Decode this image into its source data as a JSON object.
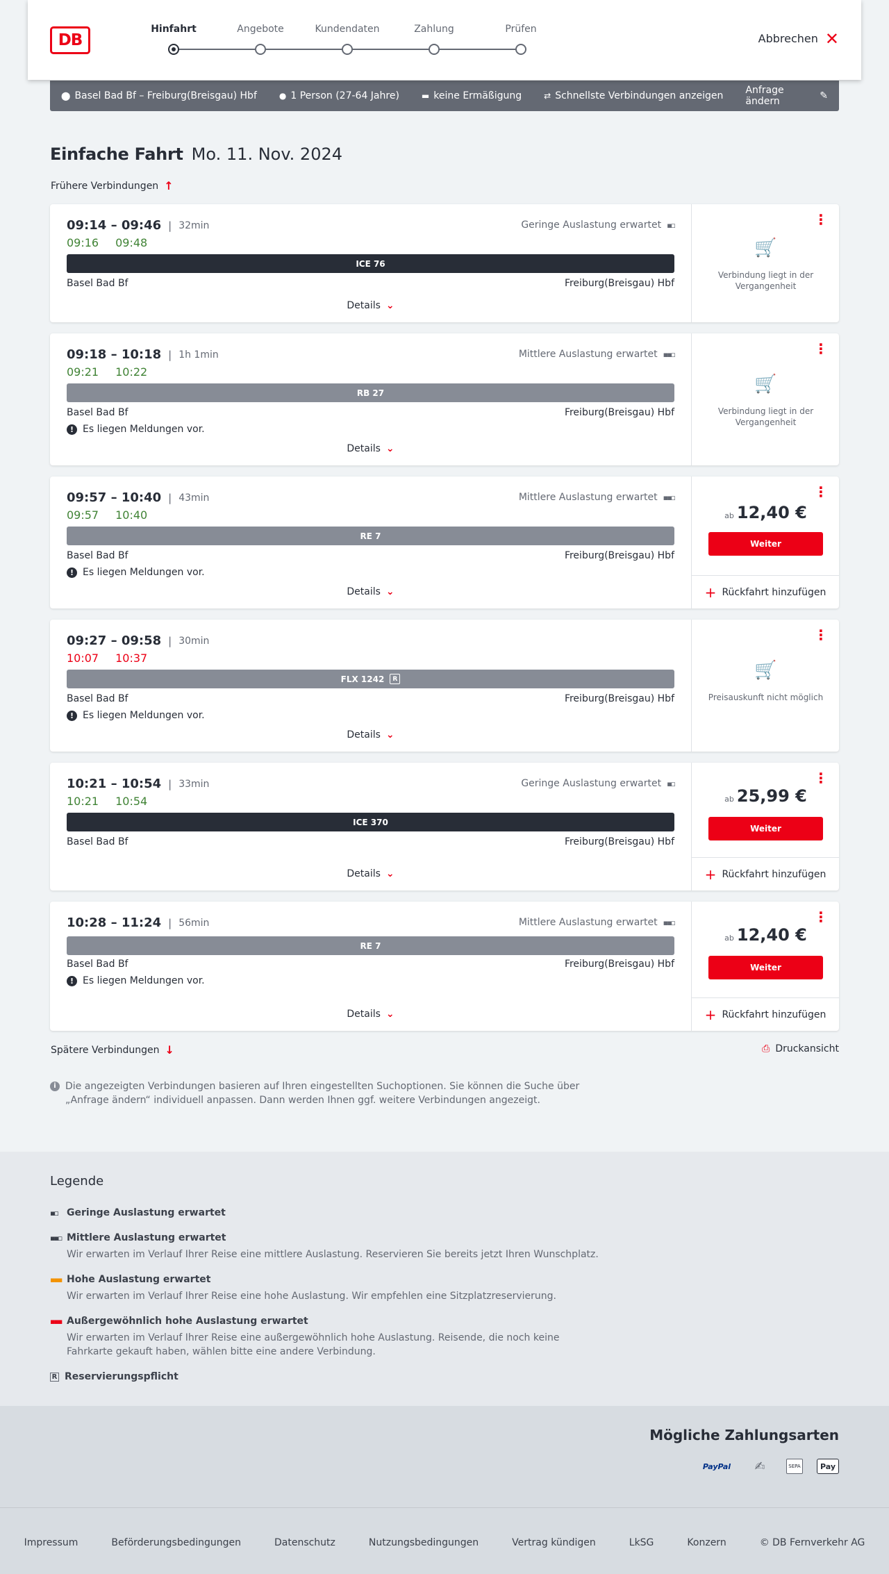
{
  "header": {
    "logo": "DB",
    "steps": [
      "Hinfahrt",
      "Angebote",
      "Kundendaten",
      "Zahlung",
      "Prüfen"
    ],
    "active_step": 0,
    "cancel_label": "Abbrechen"
  },
  "query": {
    "route": "Basel Bad Bf – Freiburg(Breisgau) Hbf",
    "passengers": "1 Person (27-64 Jahre)",
    "discount": "keine Ermäßigung",
    "fastest": "Schnellste Verbindungen anzeigen",
    "edit_label": "Anfrage ändern"
  },
  "page": {
    "title": "Einfache Fahrt",
    "date": "Mo. 11. Nov. 2024",
    "earlier_label": "Frühere Verbindungen",
    "later_label": "Spätere Verbindungen",
    "print_label": "Druckansicht",
    "info_text": "Die angezeigten Verbindungen basieren auf Ihren eingestellten Suchoptionen. Sie können die Suche über „Anfrage ändern“ individuell anpassen. Dann werden Ihnen ggf. weitere Verbindungen angezeigt."
  },
  "common": {
    "details_label": "Details",
    "weiter_label": "Weiter",
    "return_label": "Rückfahrt hinzufügen",
    "price_prefix": "ab",
    "message_text": "Es liegen Meldungen vor.",
    "from": "Basel Bad Bf",
    "to": "Freiburg(Breisgau) Hbf"
  },
  "connections": [
    {
      "times": "09:14 – 09:46",
      "duration": "32min",
      "rt_dep": "09:16",
      "rt_arr": "09:48",
      "rt_status": "ok",
      "load": "Geringe Auslastung erwartet",
      "train": "ICE 76",
      "train_style": "dark",
      "reservation": false,
      "message": false,
      "price": "",
      "status_text": "Verbindung liegt in der Vergangenheit"
    },
    {
      "times": "09:18 – 10:18",
      "duration": "1h 1min",
      "rt_dep": "09:21",
      "rt_arr": "10:22",
      "rt_status": "ok",
      "load": "Mittlere Auslastung erwartet",
      "train": "RB 27",
      "train_style": "grey",
      "reservation": false,
      "message": true,
      "price": "",
      "status_text": "Verbindung liegt in der Vergangenheit"
    },
    {
      "times": "09:57 – 10:40",
      "duration": "43min",
      "rt_dep": "09:57",
      "rt_arr": "10:40",
      "rt_status": "ok",
      "load": "Mittlere Auslastung erwartet",
      "train": "RE 7",
      "train_style": "grey",
      "reservation": false,
      "message": true,
      "price": "12,40 €",
      "status_text": ""
    },
    {
      "times": "09:27 – 09:58",
      "duration": "30min",
      "rt_dep": "10:07",
      "rt_arr": "10:37",
      "rt_status": "late",
      "load": "",
      "train": "FLX 1242",
      "train_style": "grey",
      "reservation": true,
      "message": true,
      "price": "",
      "status_text": "Preisauskunft nicht möglich"
    },
    {
      "times": "10:21 – 10:54",
      "duration": "33min",
      "rt_dep": "10:21",
      "rt_arr": "10:54",
      "rt_status": "ok",
      "load": "Geringe Auslastung erwartet",
      "train": "ICE 370",
      "train_style": "dark",
      "reservation": false,
      "message": false,
      "price": "25,99 €",
      "status_text": ""
    },
    {
      "times": "10:28 – 11:24",
      "duration": "56min",
      "rt_dep": "",
      "rt_arr": "",
      "rt_status": "ok",
      "load": "Mittlere Auslastung erwartet",
      "train": "RE 7",
      "train_style": "grey",
      "reservation": false,
      "message": true,
      "price": "12,40 €",
      "status_text": ""
    }
  ],
  "legend": {
    "title": "Legende",
    "items": [
      {
        "title": "Geringe Auslastung erwartet",
        "desc": ""
      },
      {
        "title": "Mittlere Auslastung erwartet",
        "desc": "Wir erwarten im Verlauf Ihrer Reise eine mittlere Auslastung. Reservieren Sie bereits jetzt Ihren Wunschplatz."
      },
      {
        "title": "Hohe Auslastung erwartet",
        "desc": "Wir erwarten im Verlauf Ihrer Reise eine hohe Auslastung. Wir empfehlen eine Sitzplatzreservierung."
      },
      {
        "title": "Außergewöhnlich hohe Auslastung erwartet",
        "desc": "Wir erwarten im Verlauf Ihrer Reise eine außergewöhnlich hohe Auslastung. Reisende, die noch keine Fahrkarte gekauft haben, wählen bitte eine andere Verbindung."
      },
      {
        "title": "Reservierungspflicht",
        "desc": ""
      }
    ]
  },
  "payment": {
    "title": "Mögliche Zahlungsarten",
    "paypal": "PayPal",
    "sepa": "SEPA",
    "applepay": "Pay"
  },
  "footer": {
    "links": [
      "Impressum",
      "Beförderungsbedingungen",
      "Datenschutz",
      "Nutzungsbedingungen",
      "Vertrag kündigen",
      "LkSG",
      "Konzern"
    ],
    "copyright": "© DB Fernverkehr AG"
  },
  "colors": {
    "brand": "#ec0016",
    "on_time": "#408335",
    "delay": "#ec0016",
    "dark": "#282d37",
    "grey": "#878c96"
  }
}
